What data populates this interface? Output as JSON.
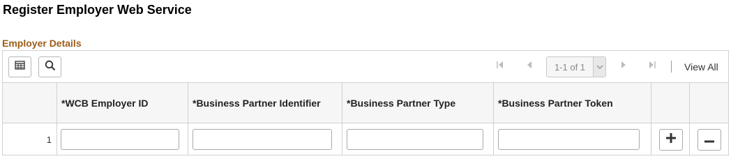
{
  "page": {
    "title": "Register Employer Web Service"
  },
  "section": {
    "title": "Employer Details"
  },
  "toolbar": {
    "personalize_icon": "grid-personalize-icon",
    "find_icon": "search-icon",
    "pager_text": "1-1 of 1",
    "view_all_label": "View All"
  },
  "grid": {
    "columns": [
      "*WCB Employer ID",
      "*Business Partner Identifier",
      "*Business Partner Type",
      "*Business Partner Token"
    ],
    "rows": [
      {
        "row_number": "1",
        "values": [
          "",
          "",
          "",
          ""
        ]
      }
    ]
  },
  "colors": {
    "section_title": "#9c5c1a",
    "border": "#d0d0d0",
    "header_bg": "#f6f6f6"
  }
}
